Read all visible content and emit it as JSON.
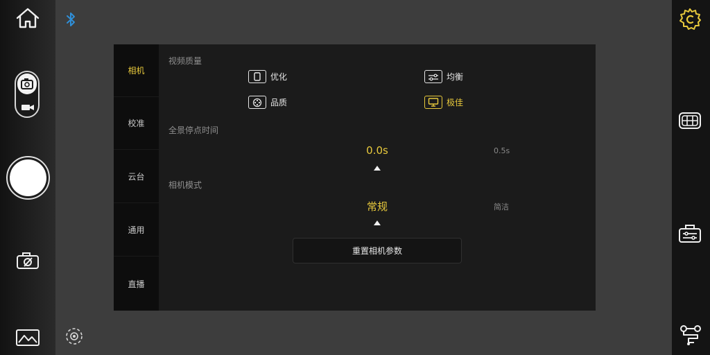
{
  "left_bar": {
    "icons": [
      "home-icon",
      "bluetooth-icon",
      "camera-video-toggle",
      "shutter-button",
      "camera-off-icon",
      "gallery-icon",
      "focus-target-icon"
    ]
  },
  "right_bar": {
    "icons": [
      "settings-icon",
      "gimbal-icon",
      "gimbal-control-icon",
      "workflow-icon"
    ]
  },
  "panel": {
    "nav": [
      {
        "label": "相机",
        "active": true
      },
      {
        "label": "校准",
        "active": false
      },
      {
        "label": "云台",
        "active": false
      },
      {
        "label": "通用",
        "active": false
      },
      {
        "label": "直播",
        "active": false
      }
    ],
    "video_quality": {
      "title": "视频质量",
      "options": [
        {
          "label": "优化",
          "icon": "phone-icon",
          "active": false
        },
        {
          "label": "均衡",
          "icon": "sliders-icon",
          "active": false
        },
        {
          "label": "品质",
          "icon": "film-reel-icon",
          "active": false
        },
        {
          "label": "极佳",
          "icon": "monitor-icon",
          "active": true
        }
      ]
    },
    "pano_pause": {
      "title": "全景停点时间",
      "selected": "0.0s",
      "next": "0.5s"
    },
    "camera_mode": {
      "title": "相机模式",
      "selected": "常规",
      "next": "简洁"
    },
    "reset_label": "重置相机参数"
  },
  "colors": {
    "accent": "#e8c93c",
    "bluetooth": "#2f8fd8",
    "panel_bg": "#1b1b1b",
    "nav_bg": "#0d0d0d"
  }
}
